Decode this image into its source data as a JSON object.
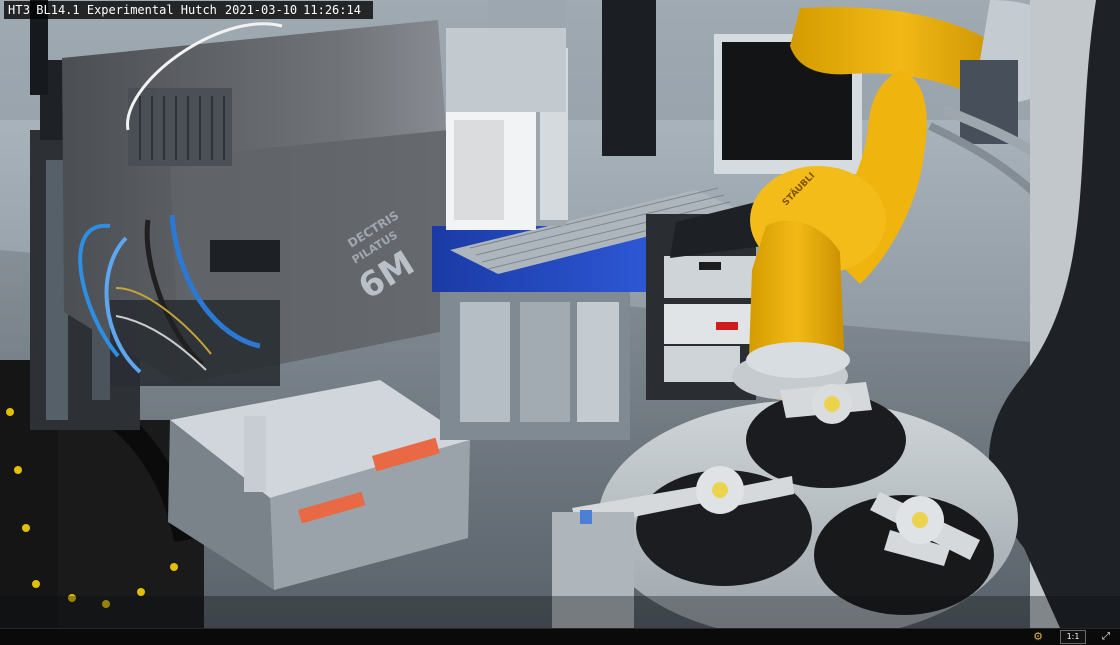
{
  "video": {
    "overlay": {
      "camera_id": "HT3",
      "location": "BL14.1 Experimental Hutch",
      "date": "2021-03-10",
      "time": "11:26:14"
    },
    "controls": {
      "aspect_ratio": "1:1"
    }
  },
  "equipment_labels": {
    "detector_brand": "DECTRIS",
    "detector_series": "PILATUS",
    "detector_model": "6M",
    "robot_brand": "STÄUBLI"
  },
  "icons": {
    "camera": "camera-icon",
    "settings": "gear-icon",
    "fullscreen": "fullscreen-icon"
  }
}
